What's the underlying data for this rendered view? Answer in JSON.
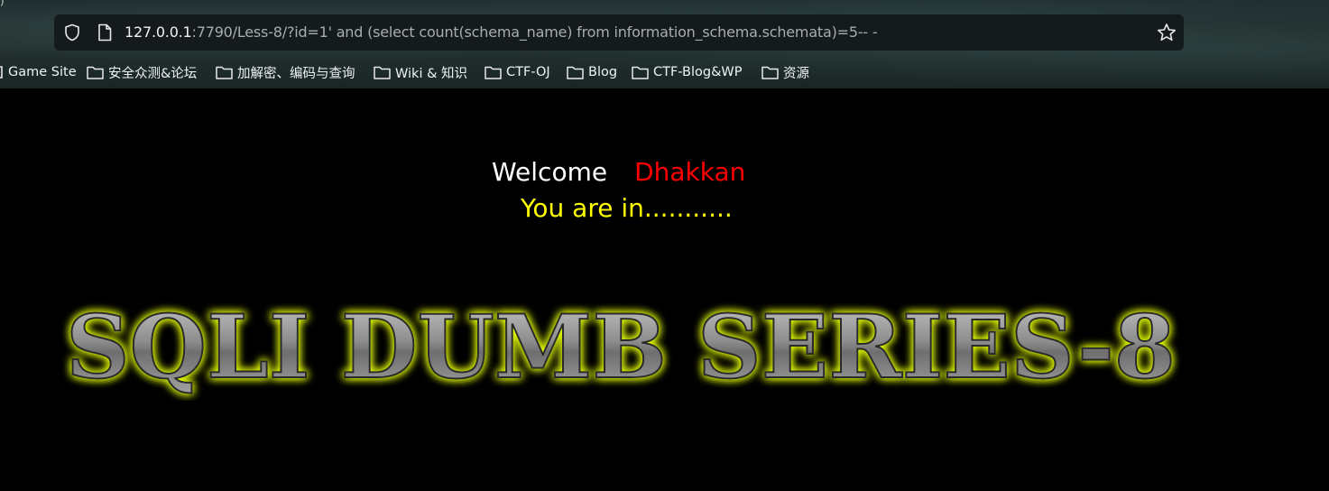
{
  "browser": {
    "url_host": "127.0.0.1",
    "url_rest": ":7790/Less-8/?id=1' and (select count(schema_name) from information_schema.schemata)=5-- -",
    "bookmarks": [
      {
        "label": "Game Site",
        "icon": "game-icon"
      },
      {
        "label": "安全众测&论坛",
        "icon": "folder-icon"
      },
      {
        "label": "加解密、编码与查询",
        "icon": "folder-icon"
      },
      {
        "label": "Wiki & 知识",
        "icon": "folder-icon"
      },
      {
        "label": "CTF-OJ",
        "icon": "folder-icon"
      },
      {
        "label": "Blog",
        "icon": "folder-icon"
      },
      {
        "label": "CTF-Blog&WP",
        "icon": "folder-icon"
      },
      {
        "label": "资源",
        "icon": "folder-icon"
      }
    ]
  },
  "page": {
    "welcome": "Welcome",
    "name": "Dhakkan",
    "status": "You are in...........",
    "banner": "SQLI DUMB SERIES-8"
  },
  "colors": {
    "background": "#000000",
    "welcome": "#ffffff",
    "name": "#ff0000",
    "status": "#ffff00",
    "banner_glow": "#e6ff00",
    "banner_metal": "#8a8a8a"
  }
}
